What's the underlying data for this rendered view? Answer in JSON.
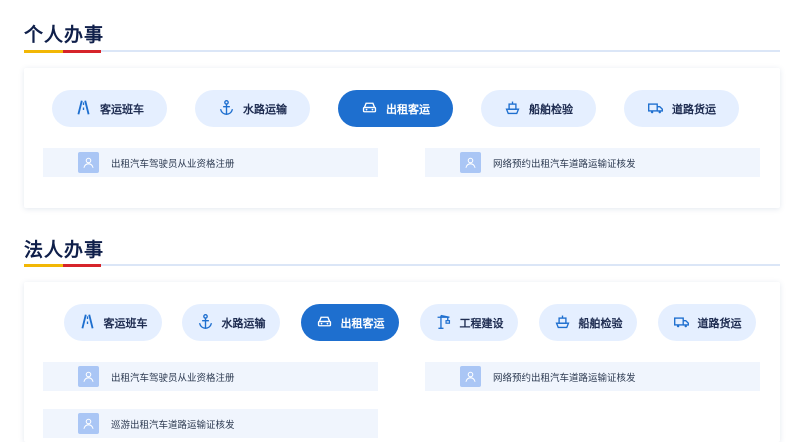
{
  "personal": {
    "title": "个人办事",
    "categories": [
      {
        "label": "客运班车",
        "icon": "road-icon"
      },
      {
        "label": "水路运输",
        "icon": "anchor-icon"
      },
      {
        "label": "出租客运",
        "icon": "taxi-icon",
        "active": true
      },
      {
        "label": "船舶检验",
        "icon": "ship-icon"
      },
      {
        "label": "道路货运",
        "icon": "truck-icon"
      }
    ],
    "items": [
      {
        "label": "出租汽车驾驶员从业资格注册"
      },
      {
        "label": "网络预约出租汽车道路运输证核发"
      }
    ]
  },
  "corporate": {
    "title": "法人办事",
    "categories": [
      {
        "label": "客运班车",
        "icon": "road-icon"
      },
      {
        "label": "水路运输",
        "icon": "anchor-icon"
      },
      {
        "label": "出租客运",
        "icon": "taxi-icon",
        "active": true
      },
      {
        "label": "工程建设",
        "icon": "crane-icon"
      },
      {
        "label": "船舶检验",
        "icon": "ship-icon"
      },
      {
        "label": "道路货运",
        "icon": "truck-icon"
      }
    ],
    "items": [
      {
        "label": "出租汽车驾驶员从业资格注册"
      },
      {
        "label": "网络预约出租汽车道路运输证核发"
      },
      {
        "label": "巡游出租汽车道路运输证核发"
      }
    ]
  },
  "colors": {
    "accent": "#1e6fcf",
    "pill": "#e5efff",
    "item_bg": "#f0f5fd",
    "yellow": "#f2b705",
    "red": "#d6242a"
  }
}
